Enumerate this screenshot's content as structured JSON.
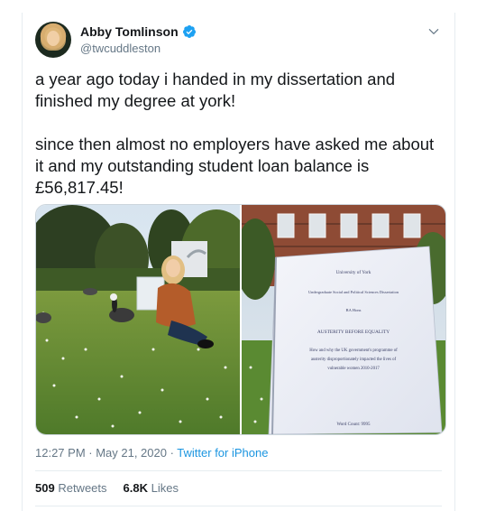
{
  "author": {
    "display_name": "Abby Tomlinson",
    "handle": "@twcuddleston",
    "verified": true
  },
  "icons": {
    "verified": "verified-badge-icon",
    "more": "chevron-down-icon"
  },
  "tweet": {
    "text": "a year ago today i handed in my dissertation and finished my degree at york!\n\nsince then almost no employers have asked me about it and my outstanding student loan balance is £56,817.45!"
  },
  "media": {
    "document": {
      "line1": "University of York",
      "line2": "Undergraduate Social and Political Sciences Dissertation",
      "line3": "BA Hons",
      "title": "AUSTERITY BEFORE EQUALITY",
      "sub1": "How and why the UK government's programme of",
      "sub2": "austerity disproportionately impacted the lives of",
      "sub3": "vulnerable women 2010-2017",
      "word_count": "Word Count: 9995"
    }
  },
  "meta": {
    "time": "12:27 PM · May 21, 2020 · ",
    "source": "Twitter for iPhone"
  },
  "stats": {
    "retweets_count": "509",
    "retweets_label": "Retweets",
    "likes_count": "6.8K",
    "likes_label": "Likes"
  },
  "colors": {
    "accent": "#1b95e0",
    "secondary_text": "#657786",
    "border": "#e6ecf0"
  }
}
